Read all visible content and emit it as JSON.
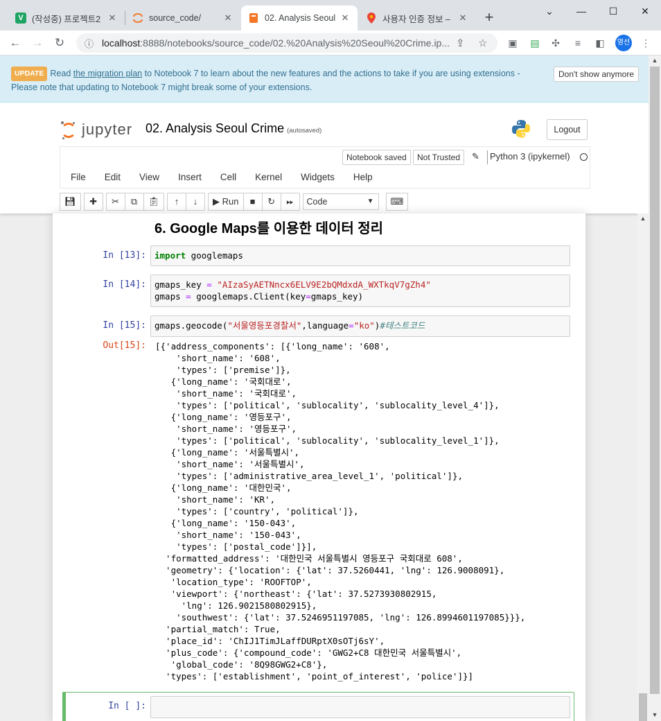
{
  "browser": {
    "tabs": [
      {
        "title": "(작성중) 프로젝트2",
        "favicon": "V",
        "favicon_color": "#20a464"
      },
      {
        "title": "source_code/",
        "favicon": "jupyter"
      },
      {
        "title": "02. Analysis Seoul",
        "favicon": "notebook",
        "active": true
      },
      {
        "title": "사용자 인증 정보 –",
        "favicon": "maps"
      }
    ],
    "new_tab": "+",
    "url_host": "localhost",
    "url_rest": ":8888/notebooks/source_code/02.%20Analysis%20Seoul%20Crime.ip...",
    "profile": "영선",
    "win": {
      "minimize": "⌄",
      "restore": "—",
      "max": "☐",
      "close": "✕"
    }
  },
  "banner": {
    "badge": "UPDATE",
    "text_pre": "Read ",
    "link": "the migration plan",
    "text_post": " to Notebook 7 to learn about the new features and the actions to take if you are using extensions -",
    "line2": "Please note that updating to Notebook 7 might break some of your extensions.",
    "dismiss": "Don't show anymore"
  },
  "header": {
    "logo_text": "jupyter",
    "notebook_title": "02. Analysis Seoul Crime",
    "autosave": "(autosaved)",
    "logout": "Logout"
  },
  "menubar": {
    "items": [
      "File",
      "Edit",
      "View",
      "Insert",
      "Cell",
      "Kernel",
      "Widgets",
      "Help"
    ],
    "notebook_saved": "Notebook saved",
    "not_trusted": "Not Trusted",
    "kernel": "Python 3 (ipykernel)"
  },
  "toolbar": {
    "run": "Run",
    "cell_type": "Code"
  },
  "cells": {
    "heading": "6. Google Maps를 이용한 데이터 정리",
    "c1_prompt": "In [13]:",
    "c2_prompt": "In [14]:",
    "c3_prompt": "In [15]:",
    "out_prompt": "Out[15]:",
    "empty_prompt": "In [ ]:",
    "c1_kw": "import",
    "c1_rest": " googlemaps",
    "c2_l1a": "gmaps_key ",
    "c2_l1b": "=",
    "c2_l1c": " \"AIzaSyAETNncx6ELV9E2bQMdxdA_WXTkqV7gZh4\"",
    "c2_l2a": "gmaps ",
    "c2_l2b": "=",
    "c2_l2c": " googlemaps.Client(key",
    "c2_l2d": "=",
    "c2_l2e": "gmaps_key)",
    "c3_a": "gmaps.geocode(",
    "c3_b": "\"서울영등포경찰서\"",
    "c3_c": ",language",
    "c3_d": "=",
    "c3_e": "\"ko\"",
    "c3_f": ")",
    "c3_g": "#테스트코드",
    "output": "[{'address_components': [{'long_name': '608',\n    'short_name': '608',\n    'types': ['premise']},\n   {'long_name': '국회대로',\n    'short_name': '국회대로',\n    'types': ['political', 'sublocality', 'sublocality_level_4']},\n   {'long_name': '영등포구',\n    'short_name': '영등포구',\n    'types': ['political', 'sublocality', 'sublocality_level_1']},\n   {'long_name': '서울특별시',\n    'short_name': '서울특별시',\n    'types': ['administrative_area_level_1', 'political']},\n   {'long_name': '대한민국',\n    'short_name': 'KR',\n    'types': ['country', 'political']},\n   {'long_name': '150-043',\n    'short_name': '150-043',\n    'types': ['postal_code']}],\n  'formatted_address': '대한민국 서울특별시 영등포구 국회대로 608',\n  'geometry': {'location': {'lat': 37.5260441, 'lng': 126.9008091},\n   'location_type': 'ROOFTOP',\n   'viewport': {'northeast': {'lat': 37.5273930802915,\n     'lng': 126.9021580802915},\n    'southwest': {'lat': 37.5246951197085, 'lng': 126.8994601197085}}},\n  'partial_match': True,\n  'place_id': 'ChIJ1TimJLaffDURptX0sOTj6sY',\n  'plus_code': {'compound_code': 'GWG2+C8 대한민국 서울특별시',\n   'global_code': '8Q98GWG2+C8'},\n  'types': ['establishment', 'point_of_interest', 'police']}]"
  }
}
